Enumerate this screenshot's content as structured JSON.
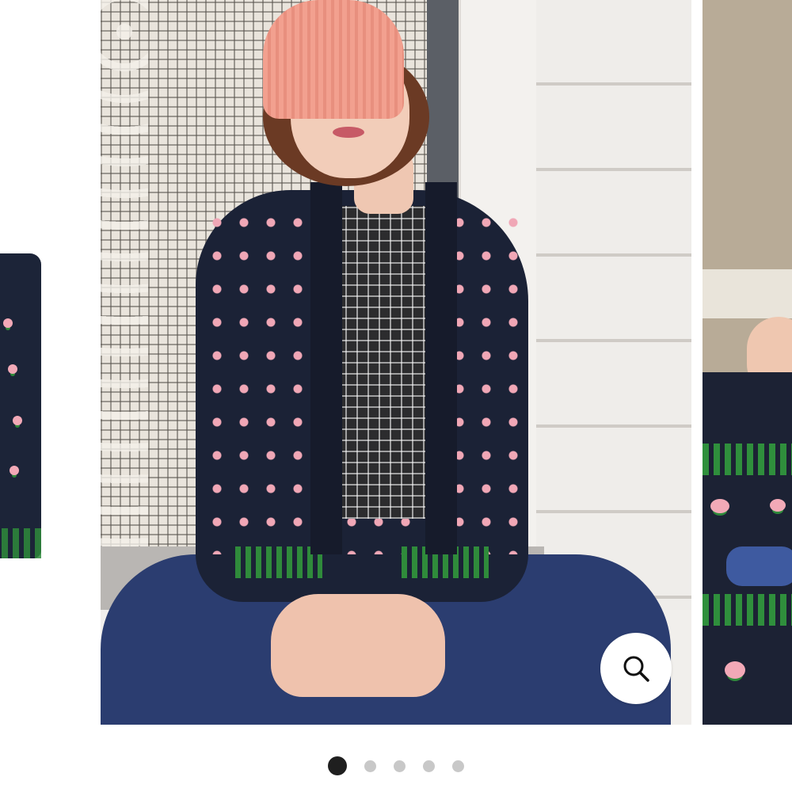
{
  "carousel": {
    "slide_count": 5,
    "active_index": 0,
    "zoom_icon": "magnifier-icon",
    "colors": {
      "active_dot": "#1f1f1f",
      "inactive_dot": "#c8c8c8",
      "zoom_button_bg": "#ffffff"
    }
  }
}
